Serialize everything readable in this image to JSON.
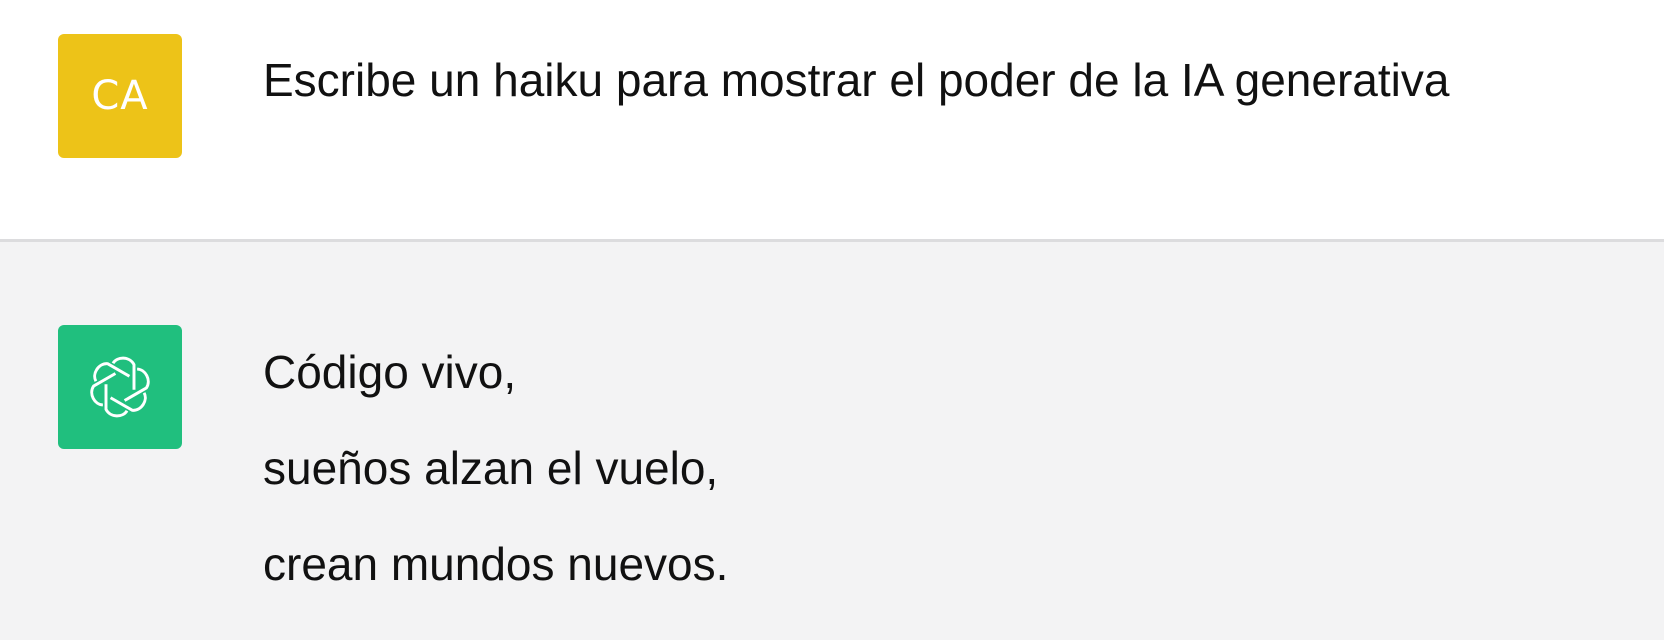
{
  "colors": {
    "user_avatar_bg": "#EDC318",
    "assistant_avatar_bg": "#20BF7E",
    "user_turn_bg": "#FFFFFF",
    "assistant_turn_bg": "#F3F3F4"
  },
  "user_turn": {
    "avatar_initials": "CA",
    "message": "Escribe un haiku para mostrar el poder de la IA generativa"
  },
  "assistant_turn": {
    "avatar_icon": "openai-logo-icon",
    "lines": [
      "Código vivo,",
      "sueños alzan el vuelo,",
      "crean mundos nuevos."
    ]
  }
}
